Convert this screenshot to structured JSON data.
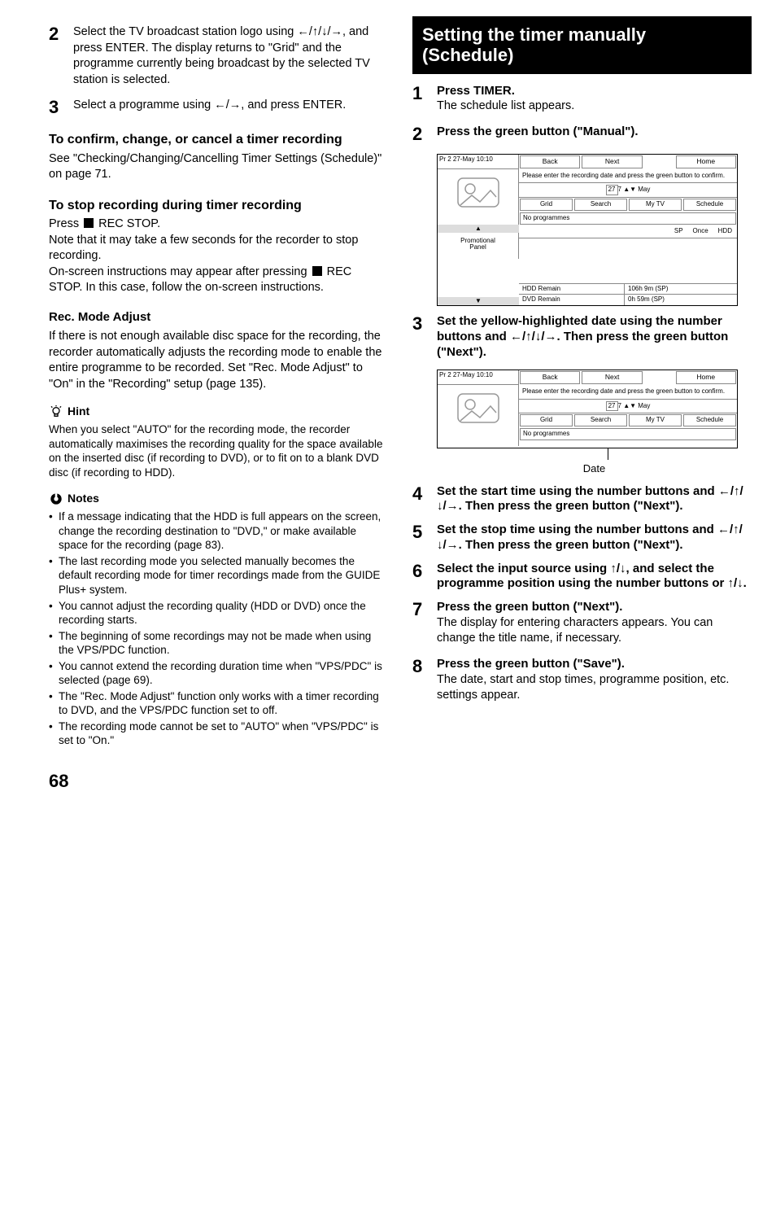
{
  "left": {
    "step2": {
      "text": "Select the TV broadcast station logo using ←/↑/↓/→, and press ENTER. The display returns to \"Grid\" and the programme currently being broadcast by the selected TV station is selected."
    },
    "step3": {
      "text": "Select a programme using ←/→, and press ENTER."
    },
    "confirm_head": "To confirm, change, or cancel a timer recording",
    "confirm_body": "See \"Checking/Changing/Cancelling Timer Settings (Schedule)\" on page 71.",
    "stop_head": "To stop recording during timer recording",
    "stop_body1_pre": "Press ",
    "stop_body1_post": " REC STOP.",
    "stop_body2": "Note that it may take a few seconds for the recorder to stop recording.",
    "stop_body3_pre": "On-screen instructions may appear after pressing ",
    "stop_body3_post": " REC STOP. In this case, follow the on-screen instructions.",
    "recmode_head": "Rec. Mode Adjust",
    "recmode_body": "If there is not enough available disc space for the recording, the recorder automatically adjusts the recording mode to enable the entire programme to be recorded. Set \"Rec. Mode Adjust\" to \"On\" in the \"Recording\" setup (page 135).",
    "hint_label": "Hint",
    "hint_body": "When you select \"AUTO\" for the recording mode, the recorder automatically maximises the recording quality for the space available on the inserted disc (if recording to DVD), or to fit on to a blank DVD disc (if recording to HDD).",
    "notes_label": "Notes",
    "notes": [
      "If a message indicating that the HDD is full appears on the screen, change the recording destination to \"DVD,\" or make available space for the recording (page 83).",
      "The last recording mode you selected manually becomes the default recording mode for timer recordings made from the GUIDE Plus+ system.",
      "You cannot adjust the recording quality (HDD or DVD) once the recording starts.",
      "The beginning of some recordings may not be made when using the VPS/PDC function.",
      "You cannot extend the recording duration time when \"VPS/PDC\" is selected (page 69).",
      "The \"Rec. Mode Adjust\" function only works with a timer recording to DVD, and the VPS/PDC function set to off.",
      "The recording mode cannot be set to \"AUTO\" when \"VPS/PDC\" is set to \"On.\""
    ]
  },
  "right": {
    "title": "Setting the timer manually (Schedule)",
    "step1_head": "Press TIMER.",
    "step1_body": "The schedule list appears.",
    "step2_head": "Press the green button (\"Manual\").",
    "scr": {
      "topleft": "Pr 2    27-May 10:10",
      "back": "Back",
      "next": "Next",
      "home": "Home",
      "msg": "Please enter the recording date and press the green button to confirm.",
      "day": "27",
      "month": "May",
      "grid": "Grid",
      "search": "Search",
      "mytv": "My TV",
      "schedule": "Schedule",
      "nop": "No programmes",
      "sp": "SP",
      "once": "Once",
      "hdd": "HDD",
      "promo": "Promotional\nPanel",
      "up": "▲",
      "dn": "▼",
      "hddrem_l": "HDD Remain",
      "hddrem_v": "106h 9m (SP)",
      "dvdrem_l": "DVD Remain",
      "dvdrem_v": "0h 59m (SP)"
    },
    "step3_head": "Set the yellow-highlighted date using the number buttons and ←/↑/↓/→. Then press the green button (\"Next\").",
    "date_callout": "Date",
    "step4_head": "Set the start time using the number buttons and ←/↑/↓/→. Then press the green button (\"Next\").",
    "step5_head": "Set the stop time using the number buttons and ←/↑/↓/→. Then press the green button (\"Next\").",
    "step6_head": "Select the input source using ↑/↓, and select the programme position using the number buttons or ↑/↓.",
    "step7_head": "Press the green button (\"Next\").",
    "step7_body": "The display for entering characters appears. You can change the title name, if necessary.",
    "step8_head": "Press the green button (\"Save\").",
    "step8_body": "The date, start and stop times, programme position, etc. settings appear."
  },
  "page_num": "68"
}
